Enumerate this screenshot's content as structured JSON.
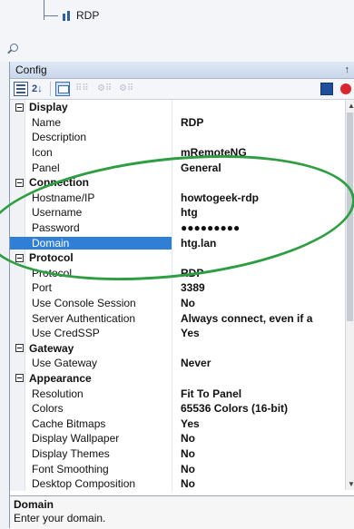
{
  "tree": {
    "node_label": "RDP"
  },
  "panel": {
    "title": "Config",
    "pin_glyph": "↑",
    "toolbar": {
      "sort_label": "2↓"
    }
  },
  "grid": {
    "rows": [
      {
        "type": "category",
        "key": "Display"
      },
      {
        "type": "prop",
        "key": "Name",
        "value": "RDP"
      },
      {
        "type": "prop",
        "key": "Description",
        "value": ""
      },
      {
        "type": "prop",
        "key": "Icon",
        "value": "mRemoteNG"
      },
      {
        "type": "prop",
        "key": "Panel",
        "value": "General"
      },
      {
        "type": "category",
        "key": "Connection"
      },
      {
        "type": "prop",
        "key": "Hostname/IP",
        "value": "howtogeek-rdp"
      },
      {
        "type": "prop",
        "key": "Username",
        "value": "htg"
      },
      {
        "type": "prop",
        "key": "Password",
        "value": "●●●●●●●●●"
      },
      {
        "type": "prop",
        "key": "Domain",
        "value": "htg.lan",
        "selected": true
      },
      {
        "type": "category",
        "key": "Protocol"
      },
      {
        "type": "prop",
        "key": "Protocol",
        "value": "RDP"
      },
      {
        "type": "prop",
        "key": "Port",
        "value": "3389"
      },
      {
        "type": "prop",
        "key": "Use Console Session",
        "value": "No"
      },
      {
        "type": "prop",
        "key": "Server Authentication",
        "value": "Always connect, even if a"
      },
      {
        "type": "prop",
        "key": "Use CredSSP",
        "value": "Yes"
      },
      {
        "type": "category",
        "key": "Gateway"
      },
      {
        "type": "prop",
        "key": "Use Gateway",
        "value": "Never"
      },
      {
        "type": "category",
        "key": "Appearance"
      },
      {
        "type": "prop",
        "key": "Resolution",
        "value": "Fit To Panel"
      },
      {
        "type": "prop",
        "key": "Colors",
        "value": "65536 Colors (16-bit)"
      },
      {
        "type": "prop",
        "key": "Cache Bitmaps",
        "value": "Yes"
      },
      {
        "type": "prop",
        "key": "Display Wallpaper",
        "value": "No"
      },
      {
        "type": "prop",
        "key": "Display Themes",
        "value": "No"
      },
      {
        "type": "prop",
        "key": "Font Smoothing",
        "value": "No"
      },
      {
        "type": "prop",
        "key": "Desktop Composition",
        "value": "No"
      }
    ]
  },
  "description": {
    "title": "Domain",
    "text": "Enter your domain."
  },
  "colors": {
    "selection": "#2f7fd6",
    "annotation": "#2f9e43",
    "disconnect": "#d9262f"
  }
}
